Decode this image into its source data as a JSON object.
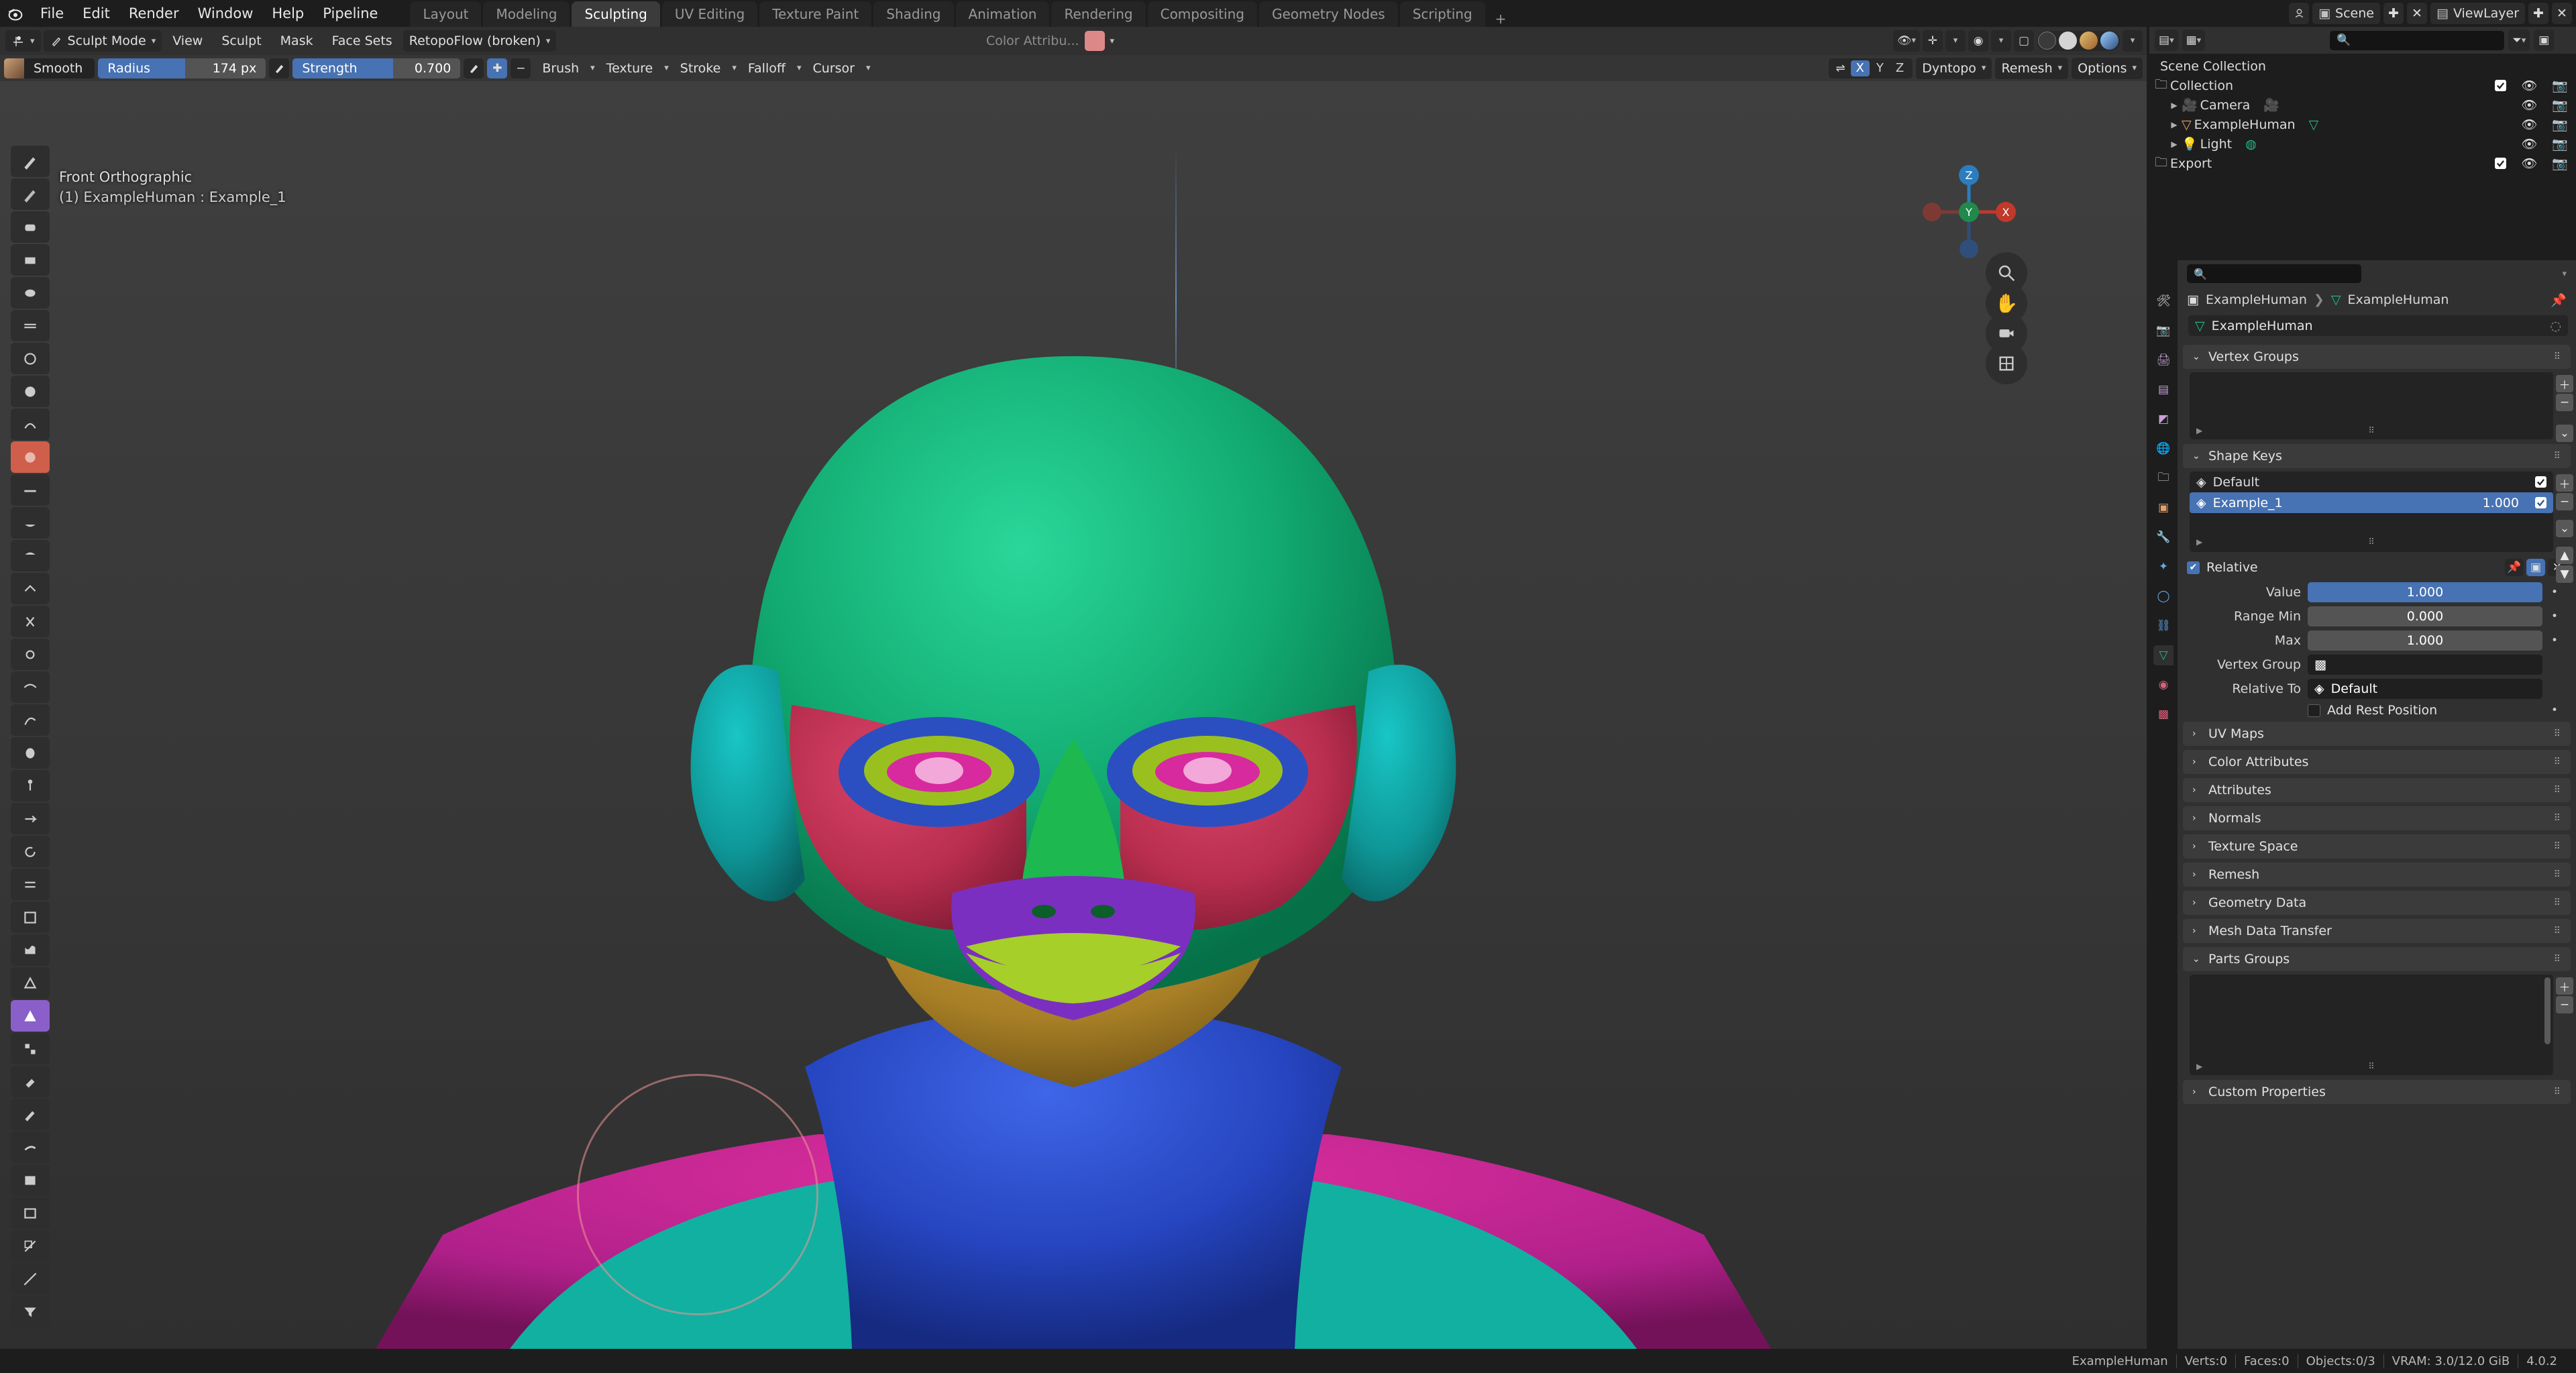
{
  "app": {
    "name": "Blender",
    "version": "4.0.2"
  },
  "topbar": {
    "menus": [
      "File",
      "Edit",
      "Render",
      "Window",
      "Help",
      "Pipeline"
    ],
    "workspace_tabs": [
      {
        "label": "Layout",
        "active": false
      },
      {
        "label": "Modeling",
        "active": false
      },
      {
        "label": "Sculpting",
        "active": true
      },
      {
        "label": "UV Editing",
        "active": false
      },
      {
        "label": "Texture Paint",
        "active": false
      },
      {
        "label": "Shading",
        "active": false
      },
      {
        "label": "Animation",
        "active": false
      },
      {
        "label": "Rendering",
        "active": false
      },
      {
        "label": "Compositing",
        "active": false
      },
      {
        "label": "Geometry Nodes",
        "active": false
      },
      {
        "label": "Scripting",
        "active": false
      }
    ],
    "add_tab_label": "+",
    "scene_name": "Scene",
    "view_layer_name": "ViewLayer"
  },
  "viewport_header": {
    "mode": "Sculpt Mode",
    "menus": [
      "View",
      "Sculpt",
      "Mask",
      "Face Sets"
    ],
    "addon_menu": "RetopoFlow (broken)"
  },
  "tool_settings": {
    "brush_name": "Smooth",
    "radius_label": "Radius",
    "radius_value": "174 px",
    "radius_fill_pct": 52,
    "strength_label": "Strength",
    "strength_value": "0.700",
    "strength_fill_pct": 60,
    "menus": [
      "Brush",
      "Texture",
      "Stroke",
      "Falloff",
      "Cursor"
    ],
    "symmetry_label": "X Y Z",
    "symmetry_axes": [
      {
        "label": "X",
        "on": true
      },
      {
        "label": "Y",
        "on": false
      },
      {
        "label": "Z",
        "on": false
      }
    ],
    "dyntopo_label": "Dyntopo",
    "remesh_label": "Remesh",
    "options_label": "Options"
  },
  "viewport": {
    "view_name": "Front Orthographic",
    "object_info": "(1) ExampleHuman : Example_1",
    "color_attribute_label": "Color Attribu...",
    "gizmo_axes": [
      "X",
      "Y",
      "Z"
    ]
  },
  "outliner": {
    "search_placeholder": "",
    "root": "Scene Collection",
    "items": [
      {
        "label": "Collection",
        "indent": 0,
        "icon": "collection-icon",
        "has_checkbox": true,
        "checked": true,
        "expandable": false
      },
      {
        "label": "Camera",
        "indent": 1,
        "icon": "camera-icon",
        "has_checkbox": false,
        "checked": false,
        "expandable": true
      },
      {
        "label": "ExampleHuman",
        "indent": 1,
        "icon": "mesh-object-icon",
        "has_checkbox": false,
        "checked": false,
        "expandable": true
      },
      {
        "label": "Light",
        "indent": 1,
        "icon": "light-icon",
        "has_checkbox": false,
        "checked": false,
        "expandable": true
      },
      {
        "label": "Export",
        "indent": 0,
        "icon": "collection-icon",
        "has_checkbox": true,
        "checked": true,
        "expandable": false
      }
    ]
  },
  "properties": {
    "search_placeholder": "",
    "breadcrumb": [
      "ExampleHuman",
      "ExampleHuman"
    ],
    "datablock_name": "ExampleHuman",
    "panels": [
      {
        "label": "Vertex Groups",
        "open": true
      },
      {
        "label": "Shape Keys",
        "open": true
      },
      {
        "label": "UV Maps",
        "open": false
      },
      {
        "label": "Color Attributes",
        "open": false
      },
      {
        "label": "Attributes",
        "open": false
      },
      {
        "label": "Normals",
        "open": false
      },
      {
        "label": "Texture Space",
        "open": false
      },
      {
        "label": "Remesh",
        "open": false
      },
      {
        "label": "Geometry Data",
        "open": false
      },
      {
        "label": "Mesh Data Transfer",
        "open": false
      },
      {
        "label": "Parts Groups",
        "open": true
      },
      {
        "label": "Custom Properties",
        "open": false
      }
    ],
    "shape_keys": {
      "title": "Shape Keys",
      "rows": [
        {
          "name": "Default",
          "value": "",
          "enabled": true,
          "selected": false
        },
        {
          "name": "Example_1",
          "value": "1.000",
          "enabled": true,
          "selected": true
        }
      ],
      "relative_label": "Relative",
      "relative_checked": true,
      "fields": [
        {
          "label": "Value",
          "value": "1.000",
          "style": "blue"
        },
        {
          "label": "Range Min",
          "value": "0.000",
          "style": "gray"
        },
        {
          "label": "Max",
          "value": "1.000",
          "style": "gray"
        }
      ],
      "vertex_group_label": "Vertex Group",
      "vertex_group_value": "",
      "relative_to_label": "Relative To",
      "relative_to_value": "Default",
      "add_rest_position_label": "Add Rest Position",
      "add_rest_position_checked": false
    },
    "vertex_groups": {
      "title": "Vertex Groups",
      "rows": []
    },
    "parts_groups": {
      "title": "Parts Groups",
      "rows": []
    }
  },
  "statusbar": {
    "object_name": "ExampleHuman",
    "verts": "Verts:0",
    "faces": "Faces:0",
    "objects": "Objects:0/3",
    "vram": "VRAM: 3.0/12.0 GiB",
    "version": "4.0.2"
  },
  "colors": {
    "accent_blue": "#4772b3",
    "active_tool": "#cf5f4a",
    "bg_dark": "#1d1d1d",
    "bg_panel": "#303030",
    "bg_header": "#353535",
    "viewport_bg": "#393939",
    "mesh_green": "#15a06a",
    "mesh_teal": "#0f8f8f",
    "mesh_blue": "#2b4fc0",
    "mesh_red": "#c0304f",
    "mesh_magenta": "#b0209a",
    "mesh_purple": "#7b2fc0",
    "mesh_gold": "#a8802a",
    "mesh_yellowgreen": "#9ac020"
  }
}
